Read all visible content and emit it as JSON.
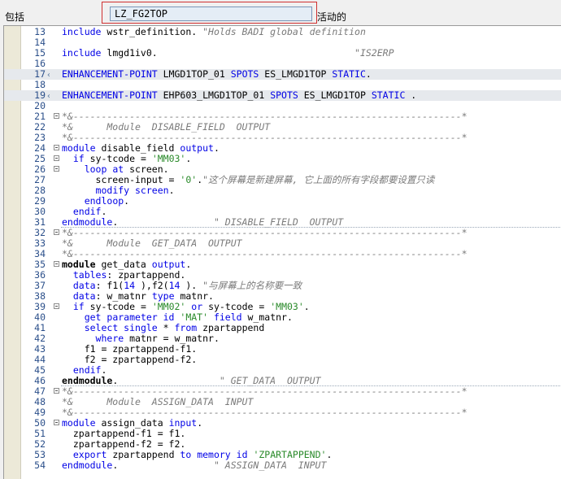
{
  "header": {
    "package_label": "包括",
    "program_name": "LZ_FG2TOP",
    "status_label": "活动的"
  },
  "lines": [
    {
      "n": "13",
      "fold": false,
      "enh": false,
      "sep": false,
      "segs": [
        [
          "k",
          "include"
        ],
        [
          "",
          "wstr_definition. "
        ],
        [
          "c",
          "\"Holds BADI global definition"
        ]
      ]
    },
    {
      "n": "14",
      "fold": false,
      "enh": false,
      "sep": false,
      "segs": []
    },
    {
      "n": "15",
      "fold": false,
      "enh": false,
      "sep": false,
      "segs": [
        [
          "k",
          "include"
        ],
        [
          "",
          "lmgd1iv0.                                   "
        ],
        [
          "c",
          "\"IS2ERP"
        ]
      ]
    },
    {
      "n": "16",
      "fold": false,
      "enh": false,
      "sep": false,
      "segs": []
    },
    {
      "n": "17",
      "fold": false,
      "enh": true,
      "sep": false,
      "marker": true,
      "segs": [
        [
          "k",
          "ENHANCEMENT-POINT"
        ],
        [
          "",
          "LMGD1TOP_01 "
        ],
        [
          "k",
          "SPOTS"
        ],
        [
          "",
          "ES_LMGD1TOP "
        ],
        [
          "k",
          "STATIC"
        ],
        [
          "",
          "."
        ]
      ]
    },
    {
      "n": "18",
      "fold": false,
      "enh": false,
      "sep": false,
      "segs": []
    },
    {
      "n": "19",
      "fold": false,
      "enh": true,
      "sep": false,
      "marker": true,
      "segs": [
        [
          "k",
          "ENHANCEMENT-POINT"
        ],
        [
          "",
          "EHP603_LMGD1TOP_01 "
        ],
        [
          "k",
          "SPOTS"
        ],
        [
          "",
          "ES_LMGD1TOP "
        ],
        [
          "k",
          "STATIC"
        ],
        [
          "",
          " ."
        ]
      ]
    },
    {
      "n": "20",
      "fold": false,
      "enh": false,
      "sep": false,
      "segs": []
    },
    {
      "n": "21",
      "fold": true,
      "enh": false,
      "sep": false,
      "segs": [
        [
          "c",
          "*&---------------------------------------------------------------------*"
        ]
      ]
    },
    {
      "n": "22",
      "fold": false,
      "enh": false,
      "sep": false,
      "segs": [
        [
          "c",
          "*&      Module  DISABLE_FIELD  OUTPUT"
        ]
      ]
    },
    {
      "n": "23",
      "fold": false,
      "enh": false,
      "sep": false,
      "segs": [
        [
          "c",
          "*&---------------------------------------------------------------------*"
        ]
      ]
    },
    {
      "n": "24",
      "fold": true,
      "enh": false,
      "sep": false,
      "segs": [
        [
          "k",
          "module"
        ],
        [
          "",
          "disable_field "
        ],
        [
          "k",
          "output"
        ],
        [
          "",
          "."
        ]
      ]
    },
    {
      "n": "25",
      "fold": true,
      "enh": false,
      "sep": false,
      "segs": [
        [
          "",
          "  "
        ],
        [
          "k",
          "if"
        ],
        [
          "",
          "sy-tcode = "
        ],
        [
          "s",
          "'MM03'"
        ],
        [
          "",
          "."
        ]
      ]
    },
    {
      "n": "26",
      "fold": true,
      "enh": false,
      "sep": false,
      "segs": [
        [
          "",
          "    "
        ],
        [
          "k",
          "loop at"
        ],
        [
          "",
          "screen."
        ]
      ]
    },
    {
      "n": "27",
      "fold": false,
      "enh": false,
      "sep": false,
      "segs": [
        [
          "",
          "      screen-input = "
        ],
        [
          "s",
          "'0'"
        ],
        [
          "",
          "."
        ],
        [
          "c",
          "\"这个屏幕是新建屏幕, 它上面的所有字段都要设置只读"
        ]
      ]
    },
    {
      "n": "28",
      "fold": false,
      "enh": false,
      "sep": false,
      "segs": [
        [
          "",
          "      "
        ],
        [
          "k",
          "modify screen"
        ],
        [
          "",
          "."
        ]
      ]
    },
    {
      "n": "29",
      "fold": false,
      "enh": false,
      "sep": false,
      "segs": [
        [
          "",
          "    "
        ],
        [
          "k",
          "endloop"
        ],
        [
          "",
          "."
        ]
      ]
    },
    {
      "n": "30",
      "fold": false,
      "enh": false,
      "sep": false,
      "segs": [
        [
          "",
          "  "
        ],
        [
          "k",
          "endif"
        ],
        [
          "",
          "."
        ]
      ]
    },
    {
      "n": "31",
      "fold": false,
      "enh": false,
      "sep": true,
      "segs": [
        [
          "k",
          "endmodule"
        ],
        [
          "",
          ".                 "
        ],
        [
          "c",
          "\" DISABLE_FIELD  OUTPUT"
        ]
      ]
    },
    {
      "n": "32",
      "fold": true,
      "enh": false,
      "sep": false,
      "segs": [
        [
          "c",
          "*&---------------------------------------------------------------------*"
        ]
      ]
    },
    {
      "n": "33",
      "fold": false,
      "enh": false,
      "sep": false,
      "segs": [
        [
          "c",
          "*&      Module  GET_DATA  OUTPUT"
        ]
      ]
    },
    {
      "n": "34",
      "fold": false,
      "enh": false,
      "sep": false,
      "segs": [
        [
          "c",
          "*&---------------------------------------------------------------------*"
        ]
      ]
    },
    {
      "n": "35",
      "fold": true,
      "enh": false,
      "sep": false,
      "segs": [
        [
          "kb",
          "module"
        ],
        [
          "",
          "get_data "
        ],
        [
          "k",
          "output"
        ],
        [
          "",
          "."
        ]
      ]
    },
    {
      "n": "36",
      "fold": false,
      "enh": false,
      "sep": false,
      "segs": [
        [
          "",
          "  "
        ],
        [
          "k",
          "tables"
        ],
        [
          "",
          ": zpartappend."
        ]
      ]
    },
    {
      "n": "37",
      "fold": false,
      "enh": false,
      "sep": false,
      "segs": [
        [
          "",
          "  "
        ],
        [
          "k",
          "data"
        ],
        [
          "",
          ": f1("
        ],
        [
          "k",
          "14"
        ],
        [
          "",
          "),f2("
        ],
        [
          "k",
          "14"
        ],
        [
          "",
          "). "
        ],
        [
          "c",
          "\"与屏幕上的名称要一致"
        ]
      ]
    },
    {
      "n": "38",
      "fold": false,
      "enh": false,
      "sep": false,
      "segs": [
        [
          "",
          "  "
        ],
        [
          "k",
          "data"
        ],
        [
          "",
          ": w_matnr "
        ],
        [
          "k",
          "type"
        ],
        [
          "",
          "matnr."
        ]
      ]
    },
    {
      "n": "39",
      "fold": true,
      "enh": false,
      "sep": false,
      "segs": [
        [
          "",
          "  "
        ],
        [
          "k",
          "if"
        ],
        [
          "",
          "sy-tcode = "
        ],
        [
          "s",
          "'MM02'"
        ],
        [
          "k",
          " or"
        ],
        [
          "",
          "sy-tcode = "
        ],
        [
          "s",
          "'MM03'"
        ],
        [
          "",
          "."
        ]
      ]
    },
    {
      "n": "40",
      "fold": false,
      "enh": false,
      "sep": false,
      "segs": [
        [
          "",
          "    "
        ],
        [
          "k",
          "get parameter id"
        ],
        [
          "s",
          "'MAT'"
        ],
        [
          "k",
          " field"
        ],
        [
          "",
          "w_matnr."
        ]
      ]
    },
    {
      "n": "41",
      "fold": false,
      "enh": false,
      "sep": false,
      "segs": [
        [
          "",
          "    "
        ],
        [
          "k",
          "select single"
        ],
        [
          "",
          "* "
        ],
        [
          "k",
          "from"
        ],
        [
          "",
          "zpartappend"
        ]
      ]
    },
    {
      "n": "42",
      "fold": false,
      "enh": false,
      "sep": false,
      "segs": [
        [
          "",
          "      "
        ],
        [
          "k",
          "where"
        ],
        [
          "",
          "matnr = w_matnr."
        ]
      ]
    },
    {
      "n": "43",
      "fold": false,
      "enh": false,
      "sep": false,
      "segs": [
        [
          "",
          "    f1 = zpartappend-f1."
        ]
      ]
    },
    {
      "n": "44",
      "fold": false,
      "enh": false,
      "sep": false,
      "segs": [
        [
          "",
          "    f2 = zpartappend-f2."
        ]
      ]
    },
    {
      "n": "45",
      "fold": false,
      "enh": false,
      "sep": false,
      "segs": [
        [
          "",
          "  "
        ],
        [
          "k",
          "endif"
        ],
        [
          "",
          "."
        ]
      ]
    },
    {
      "n": "46",
      "fold": false,
      "enh": false,
      "sep": true,
      "segs": [
        [
          "kb",
          "endmodule"
        ],
        [
          "",
          ".                  "
        ],
        [
          "c",
          "\" GET_DATA  OUTPUT"
        ]
      ]
    },
    {
      "n": "47",
      "fold": true,
      "enh": false,
      "sep": false,
      "segs": [
        [
          "c",
          "*&---------------------------------------------------------------------*"
        ]
      ]
    },
    {
      "n": "48",
      "fold": false,
      "enh": false,
      "sep": false,
      "segs": [
        [
          "c",
          "*&      Module  ASSIGN_DATA  INPUT"
        ]
      ]
    },
    {
      "n": "49",
      "fold": false,
      "enh": false,
      "sep": false,
      "segs": [
        [
          "c",
          "*&---------------------------------------------------------------------*"
        ]
      ]
    },
    {
      "n": "50",
      "fold": true,
      "enh": false,
      "sep": false,
      "segs": [
        [
          "k",
          "module"
        ],
        [
          "",
          "assign_data "
        ],
        [
          "k",
          "input"
        ],
        [
          "",
          "."
        ]
      ]
    },
    {
      "n": "51",
      "fold": false,
      "enh": false,
      "sep": false,
      "segs": [
        [
          "",
          "  zpartappend-f1 = f1."
        ]
      ]
    },
    {
      "n": "52",
      "fold": false,
      "enh": false,
      "sep": false,
      "segs": [
        [
          "",
          "  zpartappend-f2 = f2."
        ]
      ]
    },
    {
      "n": "53",
      "fold": false,
      "enh": false,
      "sep": false,
      "segs": [
        [
          "",
          "  "
        ],
        [
          "k",
          "export"
        ],
        [
          "",
          "zpartappend "
        ],
        [
          "k",
          "to memory id"
        ],
        [
          "s",
          "'ZPARTAPPEND'"
        ],
        [
          "",
          "."
        ]
      ]
    },
    {
      "n": "54",
      "fold": false,
      "enh": false,
      "sep": false,
      "segs": [
        [
          "k",
          "endmodule"
        ],
        [
          "",
          ".                 "
        ],
        [
          "c",
          "\" ASSIGN_DATA  INPUT"
        ]
      ]
    }
  ]
}
